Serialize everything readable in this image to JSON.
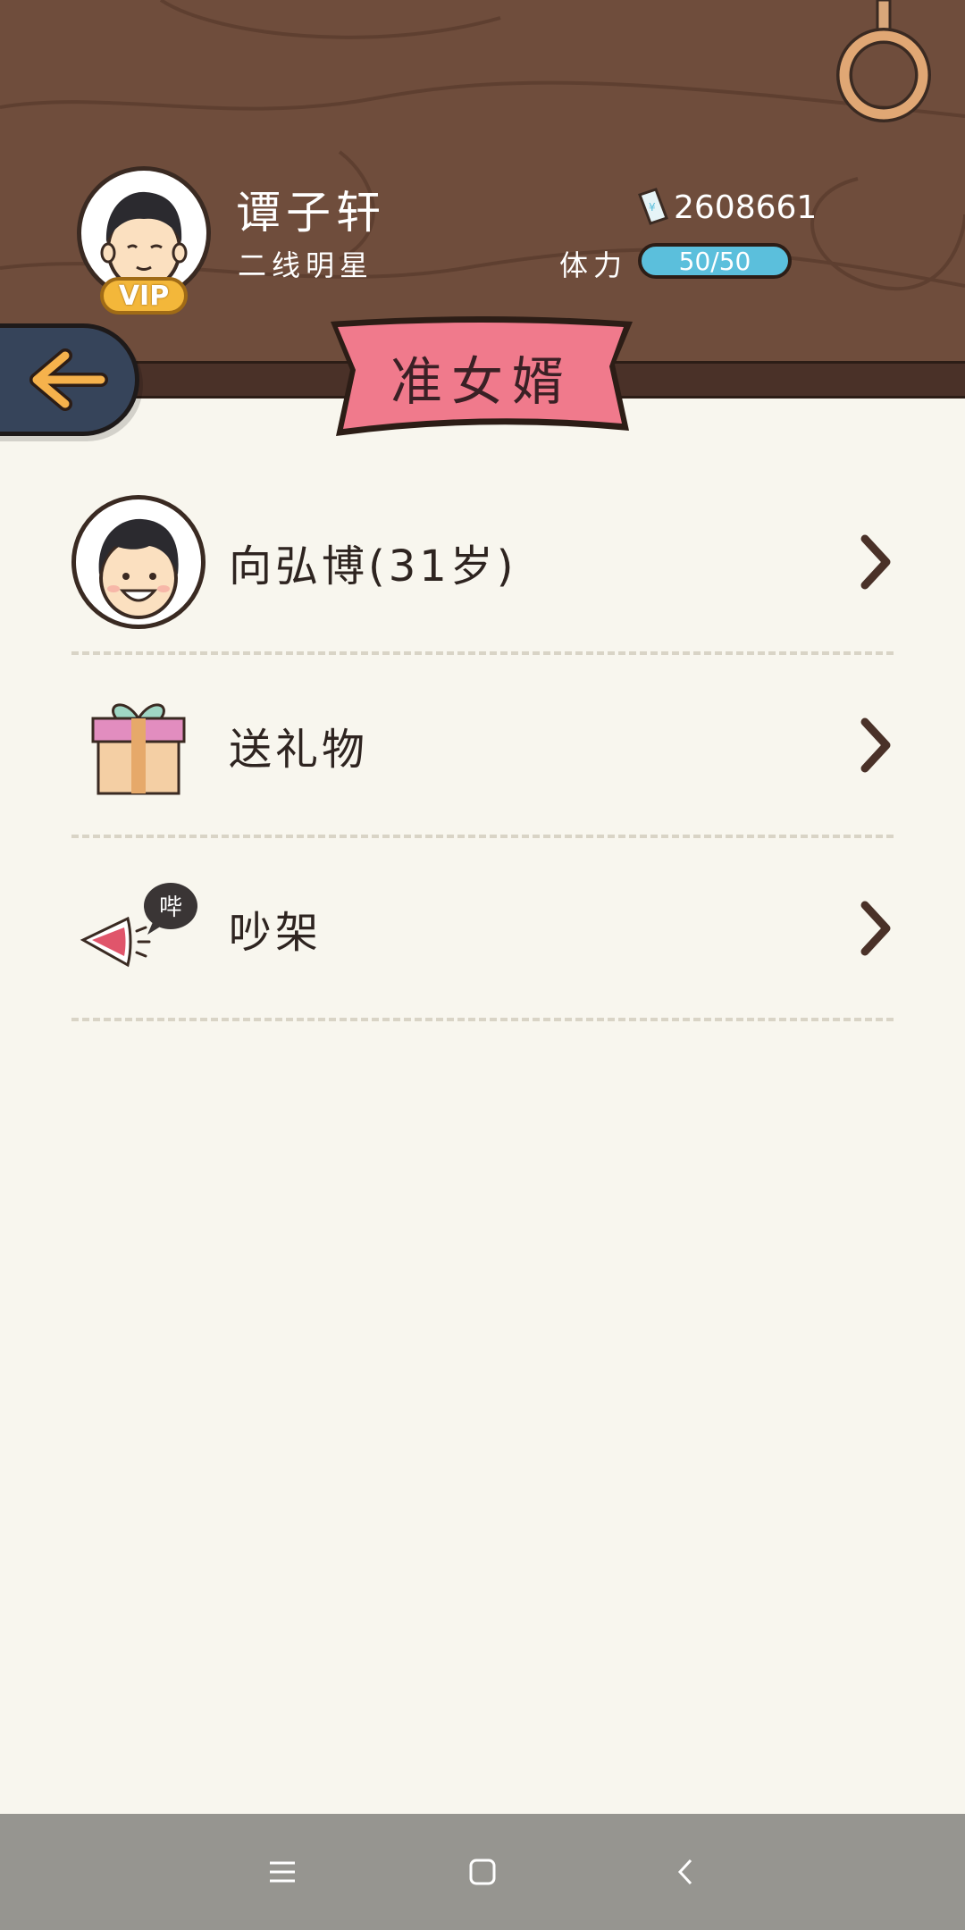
{
  "header": {
    "player_name": "谭子轩",
    "player_title": "二线明星",
    "vip_label": "VIP",
    "money_value": "2608661",
    "stamina_label": "体力",
    "stamina_value": "50/50"
  },
  "page_title": "准女婿",
  "list": [
    {
      "label": "向弘博(31岁)",
      "icon": "boy-avatar-icon"
    },
    {
      "label": "送礼物",
      "icon": "gift-box-icon"
    },
    {
      "label": "吵架",
      "icon": "shouting-mouth-icon",
      "bubble": "哔"
    }
  ],
  "colors": {
    "wood": "#6f4d3c",
    "ribbon": "#f07a8c",
    "stamina": "#5bbfdc",
    "back_button": "#36445a",
    "background": "#f8f6ee"
  }
}
